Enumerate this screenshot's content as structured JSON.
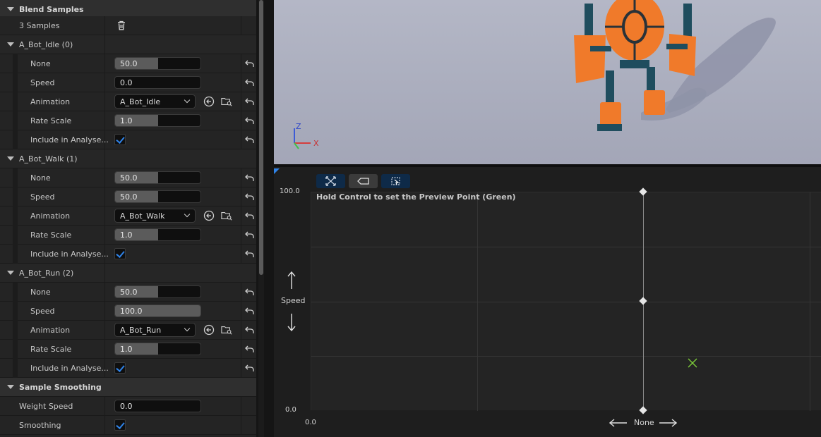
{
  "details": {
    "blend_samples": {
      "title": "Blend Samples",
      "count_label": "3 Samples"
    },
    "samples": [
      {
        "title": "A_Bot_Idle (0)",
        "none_label": "None",
        "none_value": "50.0",
        "none_fill": 0.5,
        "speed_label": "Speed",
        "speed_value": "0.0",
        "speed_fill": 0.0,
        "animation_label": "Animation",
        "animation_value": "A_Bot_Idle",
        "rate_label": "Rate Scale",
        "rate_value": "1.0",
        "rate_fill": 0.5,
        "include_label": "Include in Analyse...",
        "include_checked": true
      },
      {
        "title": "A_Bot_Walk (1)",
        "none_label": "None",
        "none_value": "50.0",
        "none_fill": 0.5,
        "speed_label": "Speed",
        "speed_value": "50.0",
        "speed_fill": 0.5,
        "animation_label": "Animation",
        "animation_value": "A_Bot_Walk",
        "rate_label": "Rate Scale",
        "rate_value": "1.0",
        "rate_fill": 0.5,
        "include_label": "Include in Analyse...",
        "include_checked": true
      },
      {
        "title": "A_Bot_Run (2)",
        "none_label": "None",
        "none_value": "50.0",
        "none_fill": 0.5,
        "speed_label": "Speed",
        "speed_value": "100.0",
        "speed_fill": 1.0,
        "animation_label": "Animation",
        "animation_value": "A_Bot_Run",
        "rate_label": "Rate Scale",
        "rate_value": "1.0",
        "rate_fill": 0.5,
        "include_label": "Include in Analyse...",
        "include_checked": true
      }
    ],
    "sample_smoothing": {
      "title": "Sample Smoothing",
      "weight_speed_label": "Weight Speed",
      "weight_speed_value": "0.0",
      "smoothing_label": "Smoothing",
      "smoothing_checked": true
    }
  },
  "viewport": {
    "axis_z": "Z",
    "axis_x": "X",
    "colors": {
      "background": "#a9acbd",
      "robot_orange": "#f07a2a",
      "robot_teal": "#1f4d5e"
    }
  },
  "graph": {
    "hint": "Hold Control to set the Preview Point (Green)",
    "y_max": "100.0",
    "y_min": "0.0",
    "x_min": "0.0",
    "y_axis_label": "Speed",
    "x_axis_label": "None",
    "toolbar": [
      "fit-icon",
      "input-icon",
      "frame-icon"
    ],
    "preview_point_color": "#7fd23a"
  }
}
